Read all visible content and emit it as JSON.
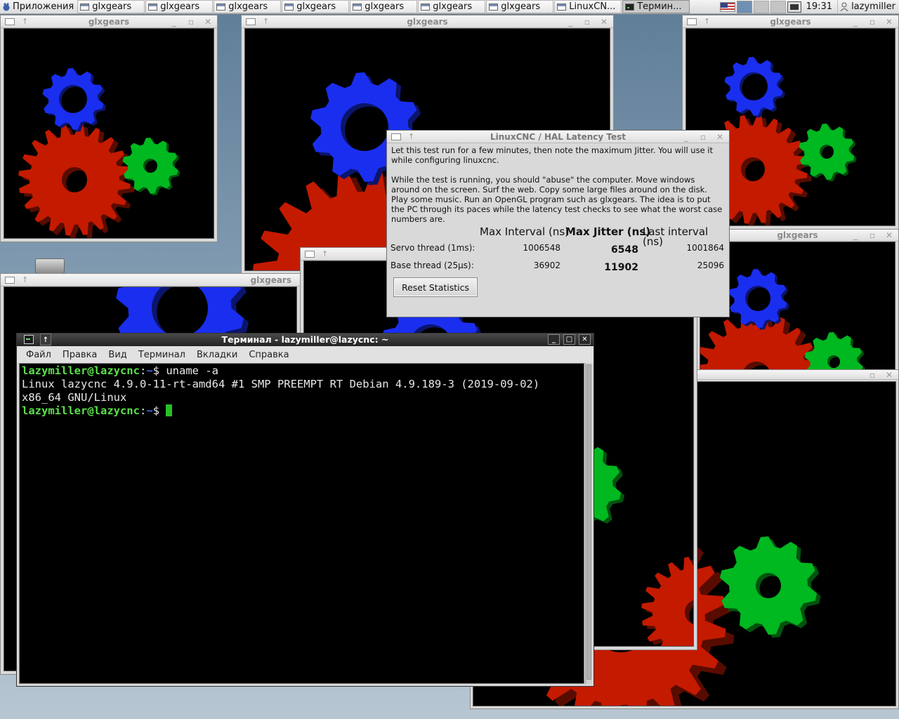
{
  "panel": {
    "apps_label": "Приложения",
    "tasks": [
      {
        "label": "glxgears",
        "kind": "gl"
      },
      {
        "label": "glxgears",
        "kind": "gl"
      },
      {
        "label": "glxgears",
        "kind": "gl"
      },
      {
        "label": "glxgears",
        "kind": "gl"
      },
      {
        "label": "glxgears",
        "kind": "gl"
      },
      {
        "label": "glxgears",
        "kind": "gl"
      },
      {
        "label": "glxgears",
        "kind": "gl"
      },
      {
        "label": "LinuxCN...",
        "kind": "gl"
      },
      {
        "label": "Термин...",
        "kind": "term"
      }
    ],
    "clock": "19:31",
    "user": "lazymiller"
  },
  "gears_windows": [
    {
      "title": "glxgears"
    },
    {
      "title": "glxgears"
    },
    {
      "title": "glxgears"
    },
    {
      "title": "glxgears"
    },
    {
      "title": "glxgears"
    },
    {
      "title": ""
    },
    {
      "title": ""
    },
    {
      "title": ""
    }
  ],
  "latency": {
    "title": "LinuxCNC / HAL Latency Test",
    "para1": "Let this test run for a few minutes, then note the maximum Jitter.  You will use it while configuring linuxcnc.",
    "para2": "While the test is running, you should \"abuse\" the computer. Move windows around on the screen. Surf the web. Copy some large files around on the disk. Play some music. Run an OpenGL program such as glxgears. The idea is to put the PC through its paces while the latency test checks to see what the worst case numbers are.",
    "headers": {
      "max_interval": "Max Interval (ns)",
      "max_jitter": "Max Jitter (ns)",
      "last_interval": "Last interval (ns)"
    },
    "rows": [
      {
        "label": "Servo thread (1ms):",
        "max_interval": "1006548",
        "max_jitter": "6548",
        "last_interval": "1001864"
      },
      {
        "label": "Base thread (25µs):",
        "max_interval": "36902",
        "max_jitter": "11902",
        "last_interval": "25096"
      }
    ],
    "reset_label": "Reset Statistics"
  },
  "terminal": {
    "title": "Терминал - lazymiller@lazycnc: ~",
    "menu": [
      "Файл",
      "Правка",
      "Вид",
      "Терминал",
      "Вкладки",
      "Справка"
    ],
    "prompt_user": "lazymiller@lazycnc",
    "prompt_sep": ":",
    "prompt_path": "~",
    "prompt_end": "$ ",
    "command": "uname -a",
    "output_line1": "Linux lazycnc 4.9.0-11-rt-amd64 #1 SMP PREEMPT RT Debian 4.9.189-3 (2019-09-02)",
    "output_line2": "x86_64 GNU/Linux"
  },
  "colors": {
    "gear_red": "#c41a00",
    "gear_green": "#00b820",
    "gear_blue": "#1a2ef0",
    "prompt_green": "#5be04a",
    "prompt_blue": "#3b6ff0"
  },
  "icons": {
    "apps": "xfce-mouse-icon",
    "window_menu": "window-menu-icon",
    "terminal": "terminal-icon",
    "user": "user-icon",
    "flag": "us-flag-icon"
  }
}
